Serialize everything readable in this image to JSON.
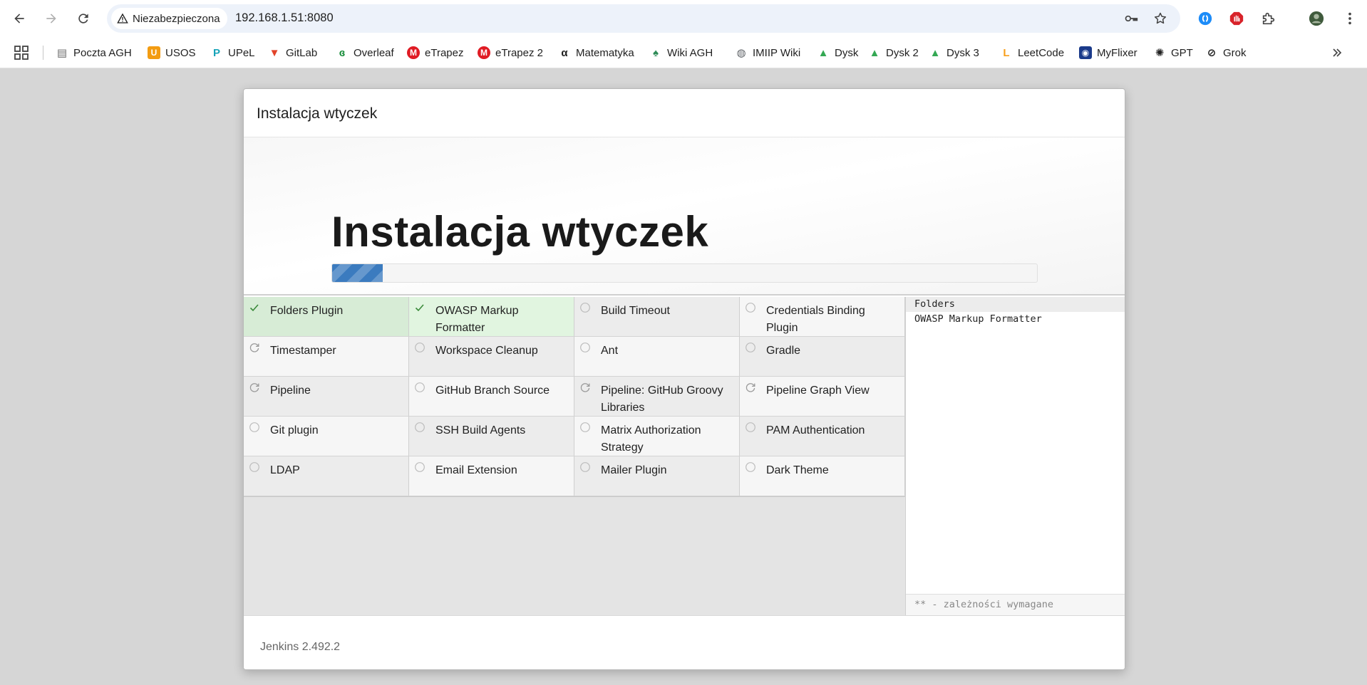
{
  "browser": {
    "security_label": "Niezabezpieczona",
    "url": "192.168.1.51:8080",
    "bookmarks": [
      {
        "label": "Poczta AGH",
        "icon": "agh-mail-icon",
        "color": "#6b6b6b"
      },
      {
        "label": "USOS",
        "icon": "usos-icon",
        "color": "#f39c12"
      },
      {
        "label": "UPeL",
        "icon": "upel-icon",
        "color": "#16a3b8"
      },
      {
        "label": "GitLab",
        "icon": "gitlab-icon",
        "color": "#e24329"
      },
      {
        "label": "Overleaf",
        "icon": "overleaf-icon",
        "color": "#138a36"
      },
      {
        "label": "eTrapez",
        "icon": "etrapez-icon",
        "color": "#e01b24"
      },
      {
        "label": "eTrapez 2",
        "icon": "etrapez-icon",
        "color": "#e01b24"
      },
      {
        "label": "Matematyka",
        "icon": "alpha-icon",
        "color": "#1f1f1f"
      },
      {
        "label": "Wiki AGH",
        "icon": "wiki-agh-icon",
        "color": "#2e8b57"
      },
      {
        "label": "IMIIP Wiki",
        "icon": "globe-icon",
        "color": "#5f6368"
      },
      {
        "label": "Dysk",
        "icon": "google-drive-icon",
        "color": "#34a853"
      },
      {
        "label": "Dysk 2",
        "icon": "google-drive-icon",
        "color": "#34a853"
      },
      {
        "label": "Dysk 3",
        "icon": "google-drive-icon",
        "color": "#34a853"
      },
      {
        "label": "LeetCode",
        "icon": "leetcode-icon",
        "color": "#f89f1b"
      },
      {
        "label": "MyFlixer",
        "icon": "myflixer-icon",
        "color": "#1a3a8a"
      },
      {
        "label": "GPT",
        "icon": "openai-icon",
        "color": "#1f1f1f"
      },
      {
        "label": "Grok",
        "icon": "grok-icon",
        "color": "#1f1f1f"
      }
    ]
  },
  "dialog": {
    "header_title": "Instalacja wtyczek",
    "hero_title": "Instalacja wtyczek",
    "progress_fraction": 0.072,
    "progress_color": "#3b7bbf",
    "plugins": [
      {
        "name": "Folders Plugin",
        "status": "installed"
      },
      {
        "name": "OWASP Markup Formatter",
        "status": "installed"
      },
      {
        "name": "Build Timeout",
        "status": "pending"
      },
      {
        "name": "Credentials Binding Plugin",
        "status": "pending"
      },
      {
        "name": "Timestamper",
        "status": "installing"
      },
      {
        "name": "Workspace Cleanup",
        "status": "pending"
      },
      {
        "name": "Ant",
        "status": "pending"
      },
      {
        "name": "Gradle",
        "status": "pending"
      },
      {
        "name": "Pipeline",
        "status": "installing"
      },
      {
        "name": "GitHub Branch Source",
        "status": "pending"
      },
      {
        "name": "Pipeline: GitHub Groovy Libraries",
        "status": "installing"
      },
      {
        "name": "Pipeline Graph View",
        "status": "installing"
      },
      {
        "name": "Git plugin",
        "status": "pending"
      },
      {
        "name": "SSH Build Agents",
        "status": "pending"
      },
      {
        "name": "Matrix Authorization Strategy",
        "status": "pending"
      },
      {
        "name": "PAM Authentication",
        "status": "pending"
      },
      {
        "name": "LDAP",
        "status": "pending"
      },
      {
        "name": "Email Extension",
        "status": "pending"
      },
      {
        "name": "Mailer Plugin",
        "status": "pending"
      },
      {
        "name": "Dark Theme",
        "status": "pending"
      }
    ],
    "dependency_log": [
      "Folders",
      "OWASP Markup Formatter"
    ],
    "deps_footer": "** - zależności wymagane",
    "version": "Jenkins 2.492.2"
  }
}
